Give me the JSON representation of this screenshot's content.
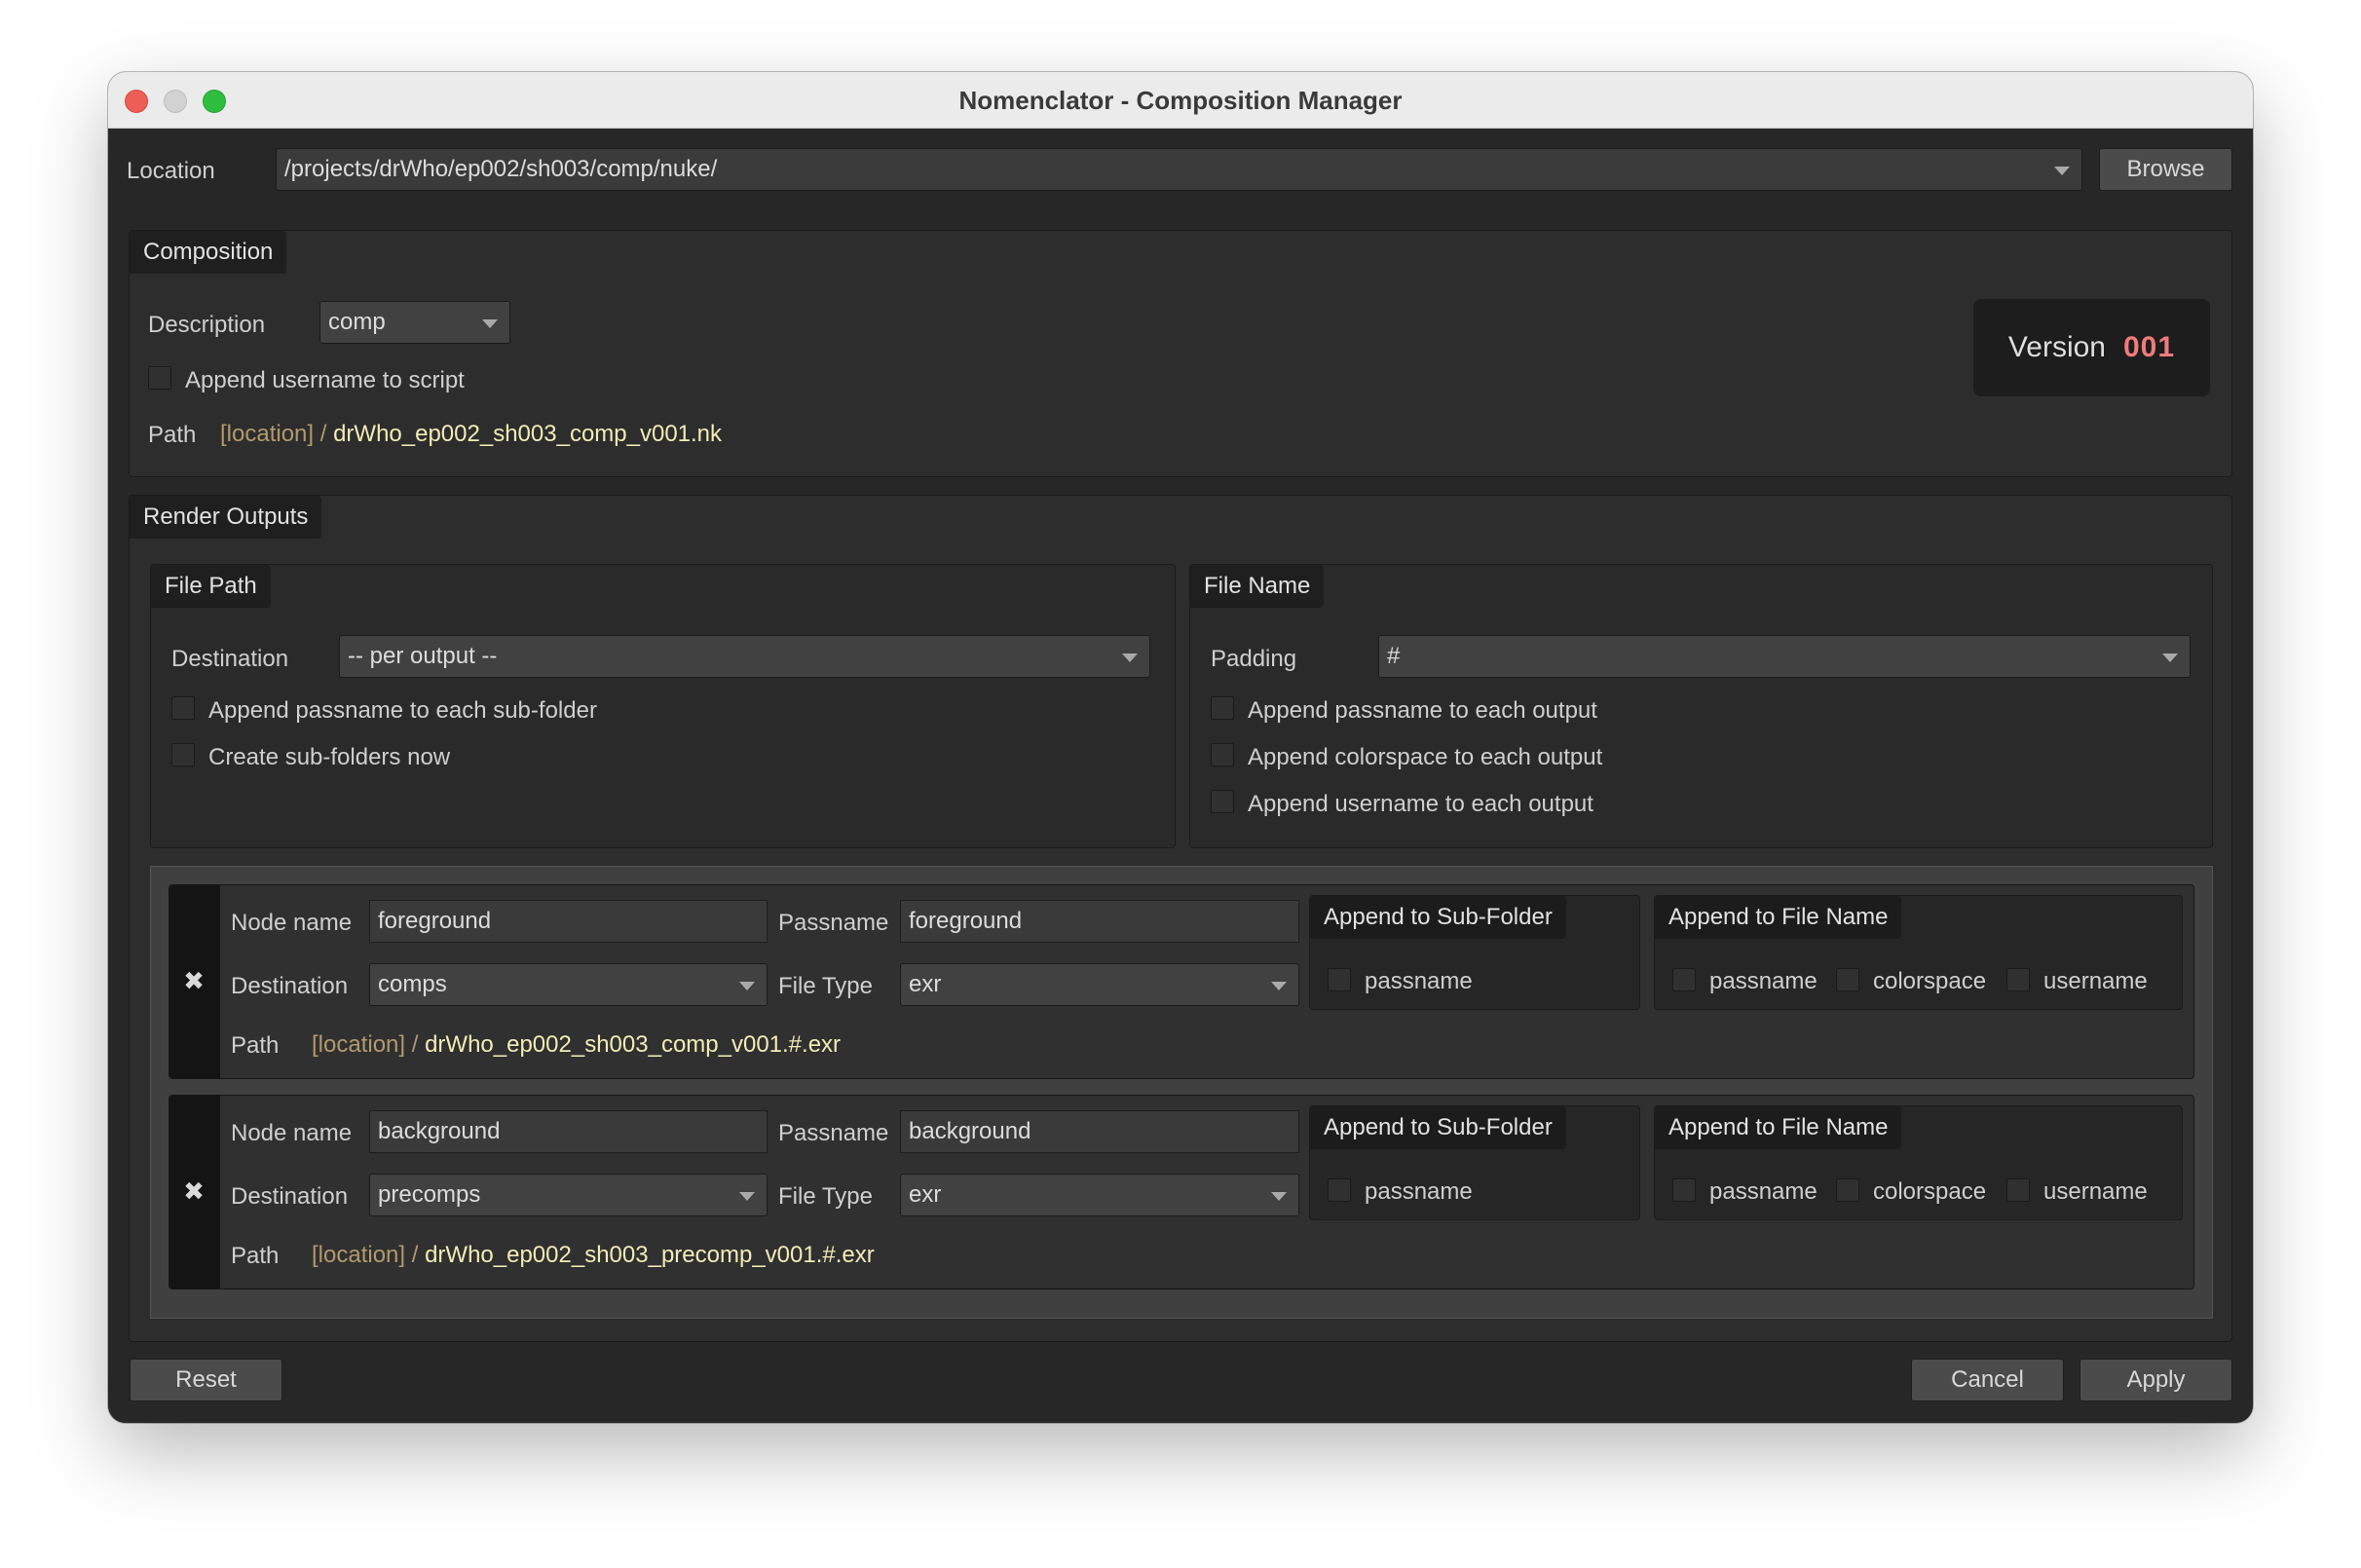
{
  "window": {
    "title": "Nomenclator - Composition Manager"
  },
  "location": {
    "label": "Location",
    "value": "/projects/drWho/ep002/sh003/comp/nuke/",
    "browse_label": "Browse"
  },
  "composition": {
    "tab": "Composition",
    "description_label": "Description",
    "description_value": "comp",
    "append_username_label": "Append username to script",
    "path_label": "Path",
    "path_location": "[location] /",
    "path_file": "drWho_ep002_sh003_comp_v001.nk",
    "version_label": "Version",
    "version_value": "001"
  },
  "render_outputs": {
    "tab": "Render Outputs",
    "file_path": {
      "tab": "File Path",
      "destination_label": "Destination",
      "destination_value": "-- per output --",
      "append_passname_label": "Append passname to each sub-folder",
      "create_subfolders_label": "Create sub-folders now"
    },
    "file_name": {
      "tab": "File Name",
      "padding_label": "Padding",
      "padding_value": "#",
      "append_passname_label": "Append passname to each output",
      "append_colorspace_label": "Append colorspace to each output",
      "append_username_label": "Append username to each output"
    },
    "outputs": [
      {
        "node_name_label": "Node name",
        "node_name": "foreground",
        "passname_label": "Passname",
        "passname": "foreground",
        "destination_label": "Destination",
        "destination": "comps",
        "file_type_label": "File Type",
        "file_type": "exr",
        "subfolder_tab": "Append to Sub-Folder",
        "subfolder_passname": "passname",
        "filename_tab": "Append to File Name",
        "fn_passname": "passname",
        "fn_colorspace": "colorspace",
        "fn_username": "username",
        "path_label": "Path",
        "path_location": "[location] /",
        "path_file": "drWho_ep002_sh003_comp_v001.#.exr"
      },
      {
        "node_name_label": "Node name",
        "node_name": "background",
        "passname_label": "Passname",
        "passname": "background",
        "destination_label": "Destination",
        "destination": "precomps",
        "file_type_label": "File Type",
        "file_type": "exr",
        "subfolder_tab": "Append to Sub-Folder",
        "subfolder_passname": "passname",
        "filename_tab": "Append to File Name",
        "fn_passname": "passname",
        "fn_colorspace": "colorspace",
        "fn_username": "username",
        "path_label": "Path",
        "path_location": "[location] /",
        "path_file": "drWho_ep002_sh003_precomp_v001.#.exr"
      }
    ]
  },
  "footer": {
    "reset_label": "Reset",
    "cancel_label": "Cancel",
    "apply_label": "Apply"
  },
  "icons": {
    "remove_output": "close-x-icon",
    "dropdown": "chevron-down-icon"
  },
  "colors": {
    "version_accent": "#f07b7b",
    "path_location": "#b19a6d",
    "path_file": "#f1ecb6"
  }
}
